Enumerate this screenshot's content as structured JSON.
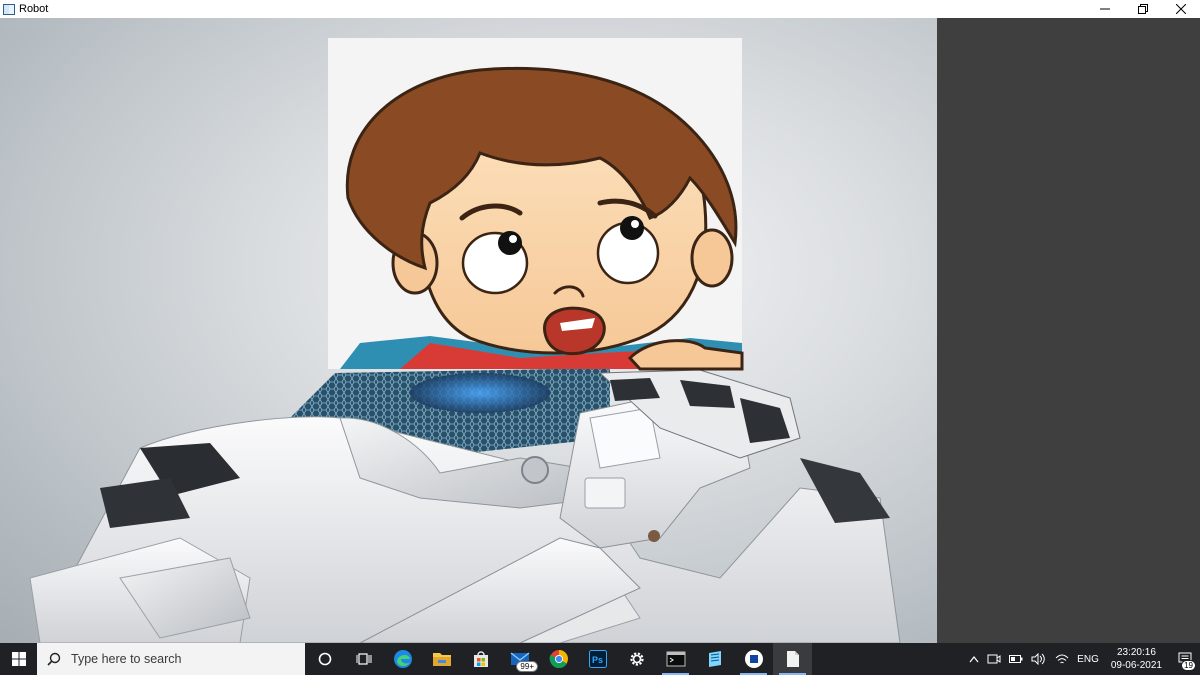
{
  "window": {
    "title": "Robot",
    "controls": {
      "minimize": "minimize",
      "maximize": "restore",
      "close": "close"
    }
  },
  "canvas": {
    "background_color": "#c8cdd1",
    "right_pane_color": "#3f3f3f",
    "scene": [
      "robot-figure",
      "cartoon-boy-face"
    ]
  },
  "taskbar": {
    "search_placeholder": "Type here to search",
    "pinned": [
      {
        "name": "cortana-icon"
      },
      {
        "name": "task-view-icon"
      },
      {
        "name": "edge-icon"
      },
      {
        "name": "file-explorer-icon"
      },
      {
        "name": "store-icon"
      },
      {
        "name": "mail-icon",
        "badge": "99+"
      },
      {
        "name": "chrome-icon"
      },
      {
        "name": "photoshop-icon"
      },
      {
        "name": "settings-icon"
      },
      {
        "name": "terminal-icon"
      },
      {
        "name": "notepad-icon"
      },
      {
        "name": "app-icon"
      },
      {
        "name": "document-icon"
      }
    ],
    "tray": {
      "language": "ENG",
      "time": "23:20:16",
      "date": "09-06-2021",
      "notification_count": "19"
    },
    "colors": {
      "taskbar": "#202124",
      "accent": "#8ab4f8"
    }
  }
}
